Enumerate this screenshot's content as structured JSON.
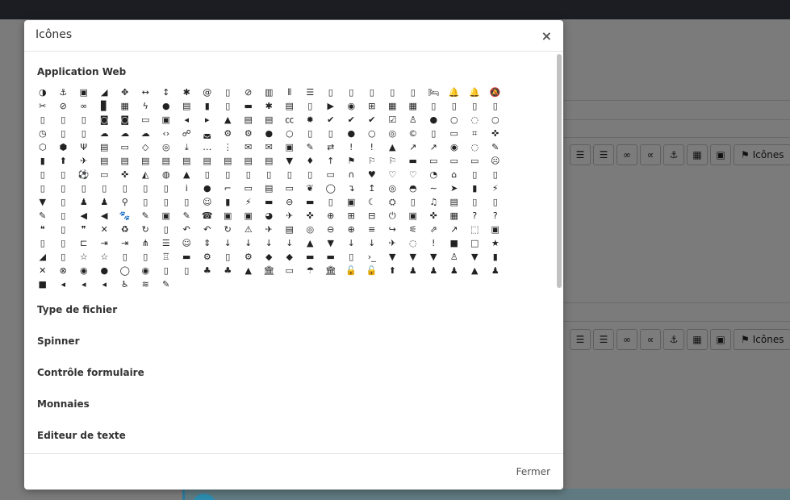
{
  "modal": {
    "title": "Icônes",
    "close_label": "×",
    "footer_button": "Fermer",
    "sections": [
      "Application Web",
      "Type de fichier",
      "Spinner",
      "Contrôle formulaire",
      "Monnaies",
      "Editeur de texte"
    ]
  },
  "background": {
    "toolbar_label": "Icônes"
  },
  "icons": [
    "◑",
    "⚓",
    "▣",
    "◢",
    "✥",
    "↔",
    "↕",
    "✱",
    "@",
    "▯",
    "⊘",
    "▥",
    "⦀",
    "☰",
    "▯",
    "▯",
    "▯",
    "▯",
    "▯",
    "🛏",
    "🔔",
    "🔔",
    "🔕",
    "✂",
    "⊘",
    "∞",
    "▊",
    "▦",
    "ϟ",
    "●",
    "▤",
    "▮",
    "▯",
    "▬",
    "✱",
    "▤",
    "▯",
    "▶",
    "◉",
    "⊞",
    "▦",
    "▦",
    "▯",
    "▯",
    "▯",
    "▯",
    "▯",
    "▯",
    "▯",
    "◙",
    "◙",
    "▭",
    "▣",
    "◂",
    "▸",
    "▲",
    "▤",
    "▤",
    "㏄",
    "✹",
    "✔",
    "✔",
    "✔",
    "☑",
    "♙",
    "●",
    "○",
    "◌",
    "○",
    "◷",
    "▯",
    "▯",
    "☁",
    "☁",
    "☁",
    "‹›",
    "☍",
    "◛",
    "⚙",
    "⚙",
    "●",
    "○",
    "▯",
    "▯",
    "●",
    "○",
    "◎",
    "©",
    "▯",
    "▭",
    "⌗",
    "✜",
    "⬡",
    "⬢",
    "Ψ",
    "▤",
    "▭",
    "◇",
    "◎",
    "⤓",
    "…",
    "⋮",
    "✉",
    "✉",
    "▣",
    "✎",
    "⇄",
    "!",
    "!",
    "▲",
    "↗",
    "↗",
    "◉",
    "◌",
    "✎",
    "▮",
    "⬆",
    "✈",
    "▤",
    "▤",
    "▤",
    "▤",
    "▤",
    "▤",
    "▤",
    "▤",
    "▤",
    "▼",
    "♦",
    "↑",
    "⚑",
    "⚐",
    "⚐",
    "▬",
    "▭",
    "▭",
    "▭",
    "☹",
    "▯",
    "▯",
    "⚽",
    "▭",
    "✜",
    "◭",
    "◍",
    "▲",
    "▯",
    "▯",
    "▯",
    "▯",
    "▯",
    "▯",
    "▭",
    "∩",
    "♥",
    "♡",
    "♡",
    "◔",
    "⌂",
    "▯",
    "▯",
    "▯",
    "▯",
    "▯",
    "▯",
    "▯",
    "▯",
    "▯",
    "i",
    "●",
    "⌐",
    "▭",
    "▤",
    "▭",
    "❦",
    "◯",
    "↴",
    "↥",
    "◎",
    "◓",
    "∼",
    "➤",
    "▮",
    "⚡",
    "▼",
    "▯",
    "♟",
    "♟",
    "⚲",
    "▯",
    "▯",
    "▯",
    "☺",
    "▮",
    "⚡",
    "▬",
    "⊖",
    "▬",
    "▯",
    "▣",
    "☾",
    "⛭",
    "▯",
    "♫",
    "▤",
    "▯",
    "▯",
    "✎",
    "▯",
    "◀",
    "◀",
    "🐾",
    "✎",
    "▣",
    "✎",
    "☎",
    "▣",
    "▣",
    "◕",
    "✈",
    "✜",
    "⊕",
    "⊞",
    "⊟",
    "⏻",
    "▣",
    "✜",
    "▦",
    "?",
    "?",
    "❝",
    "▯",
    "❞",
    "✕",
    "♻",
    "↻",
    "▯",
    "↶",
    "↶",
    "↻",
    "⚠",
    "✈",
    "▤",
    "◎",
    "⊖",
    "⊕",
    "≡",
    "↪",
    "⚟",
    "⇗",
    "↗",
    "⬚",
    "▣",
    "▯",
    "▯",
    "⊏",
    "⇥",
    "⇥",
    "⋔",
    "☰",
    "☺",
    "⇕",
    "↓",
    "↓",
    "↓",
    "↓",
    "▲",
    "▼",
    "↓",
    "↓",
    "✈",
    "◌",
    "!",
    "■",
    "□",
    "★",
    "◢",
    "▯",
    "☆",
    "☆",
    "▯",
    "▯",
    "♖",
    "▬",
    "⚙",
    "▯",
    "⚙",
    "◆",
    "◆",
    "▬",
    "▬",
    "▯",
    "›_",
    "▼",
    "▼",
    "▼",
    "♙",
    "▼",
    "▮",
    "✕",
    "⊗",
    "◉",
    "●",
    "◯",
    "◉",
    "▯",
    "▯",
    "♣",
    "♣",
    "▲",
    "🏛",
    "▭",
    "☂",
    "🏛",
    "🔓",
    "🔓",
    "⬆",
    "♟",
    "♟",
    "♟",
    "▲",
    "♟",
    "■",
    "◂",
    "◂",
    "◂",
    "♿",
    "≋",
    "✎"
  ]
}
